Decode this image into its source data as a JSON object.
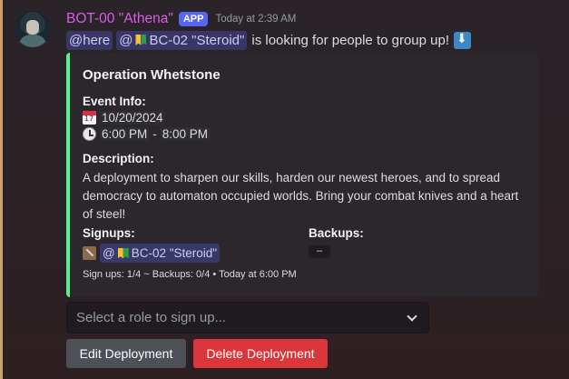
{
  "message": {
    "author": "BOT-00 \"Athena\"",
    "badge": "APP",
    "timestamp": "Today at 2:39 AM",
    "mention_here": "@here",
    "mention_user_prefix": "@",
    "mention_user_name": "BC-02 \"Steroid\"",
    "body_text": "is looking for people to group up!",
    "colors": {
      "author": "#d85ee8",
      "badge": "#5865f2",
      "embed_accent": "#57f287",
      "delete_button": "#da373c"
    }
  },
  "embed": {
    "title": "Operation Whetstone",
    "event_info_label": "Event Info:",
    "date": "10/20/2024",
    "time_start": "6:00 PM",
    "time_sep": "-",
    "time_end": "8:00 PM",
    "description_label": "Description:",
    "description": "A deployment to sharpen our skills, harden our newest heroes, and to spread democracy to automaton occupied worlds. Bring your combat knives and a heart of steel!",
    "signups_label": "Signups:",
    "signup_prefix": "@",
    "signup_name": "BC-02 \"Steroid\"",
    "backups_label": "Backups:",
    "backups_value": "–",
    "footer": "Sign ups: 1/4 ~ Backups: 0/4 • Today at 6:00 PM"
  },
  "controls": {
    "select_placeholder": "Select a role to sign up...",
    "edit_label": "Edit Deployment",
    "delete_label": "Delete Deployment"
  },
  "icons": [
    "calendar-icon",
    "clock-icon",
    "beginner-icon",
    "down-arrow-icon",
    "knife-icon",
    "chevron-down-icon"
  ]
}
